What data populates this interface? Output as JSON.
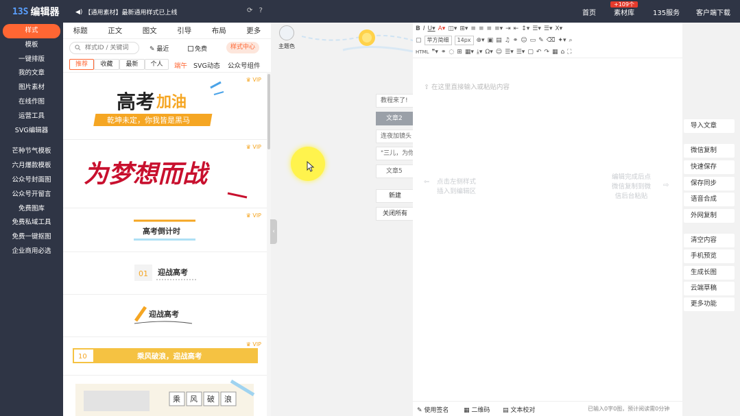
{
  "topbar": {
    "logo_mark": "13S",
    "logo_text": "编辑器",
    "notice": "【通用素材】最新通用样式已上线",
    "nav": [
      "首页",
      "素材库",
      "135服务",
      "客户端下载"
    ],
    "badge": "+109个"
  },
  "sidebar": {
    "items": [
      "样式",
      "模板",
      "一键排版",
      "我的文章",
      "图片素材",
      "在线作图",
      "运营工具",
      "SVG编辑器"
    ],
    "extras": [
      "芒种节气模板",
      "六月爆款模板",
      "公众号封面图",
      "公众号开留言",
      "免费图库",
      "免费私域工具",
      "免费一键抠图",
      "企业商用必选"
    ]
  },
  "panel": {
    "tabs": [
      "标题",
      "正文",
      "图文",
      "引导",
      "布局",
      "更多"
    ],
    "search_placeholder": "样式ID / 关键词",
    "recent": "最近",
    "free": "免费",
    "style_center": "样式中心",
    "filters": [
      "推荐",
      "收藏",
      "最新",
      "个人"
    ],
    "filter_links": [
      "端午",
      "SVG动态",
      "公众号组件"
    ],
    "vip": "VIP",
    "cards": {
      "c1_main": "高考",
      "c1_accent": "加油",
      "c1_sub": "乾坤未定，你我皆是黑马",
      "c2": "为梦想而战",
      "c3": "高考倒计时",
      "c4_num": "01",
      "c4": "迎战高考",
      "c5": "迎战高考",
      "c6_num": "10",
      "c6": "乘风破浪，迎战高考",
      "c7": [
        "乘",
        "风",
        "破",
        "浪"
      ]
    }
  },
  "theme": {
    "label": "主题色"
  },
  "articles": [
    "教程来了!",
    "文章2",
    "连夜加镜头",
    "\"三儿，为你",
    "文章5",
    "新建",
    "关闭所有"
  ],
  "editor": {
    "font": "苹方简细",
    "size": "14px",
    "placeholder": "在这里直接输入或粘贴内容",
    "hint_left": [
      "点击左侧样式",
      "插入到编辑区"
    ],
    "hint_right": [
      "编辑完成后点",
      "微信复制到微",
      "信后台粘贴"
    ],
    "status": [
      "使用签名",
      "二维码",
      "文本校对"
    ],
    "count": "已输入0字0图，预计阅读需0分钟"
  },
  "actions": [
    "导入文章",
    "微信复制",
    "快速保存",
    "保存同步",
    "语音合成",
    "外网复制",
    "清空内容",
    "手机预览",
    "生成长图",
    "云端草稿",
    "更多功能"
  ],
  "colors": {
    "accent": "#ff6633",
    "dark": "#2f3545"
  }
}
